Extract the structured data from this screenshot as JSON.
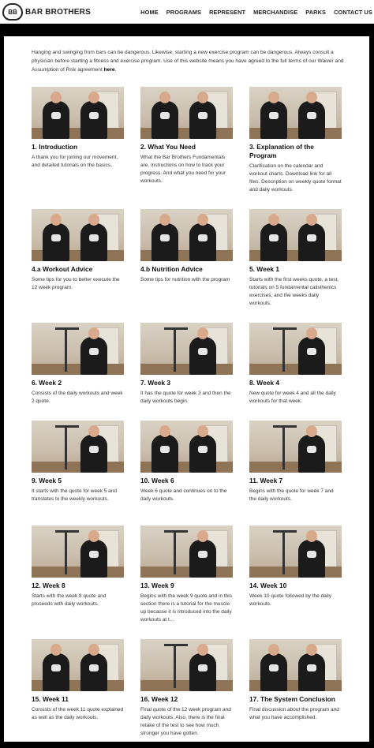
{
  "header": {
    "logo_text": "BAR BROTHERS",
    "nav": [
      "HOME",
      "PROGRAMS",
      "REPRESENT",
      "MERCHANDISE",
      "PARKS",
      "CONTACT US"
    ]
  },
  "disclaimer": {
    "text": "Hanging and swinging from bars can be dangerous. Likewise, starting a new exercise program can be dangerous. Always consult a physician before starting a fitness and exercise program. Use of this website means you have agreed to the full terms of our Waiver and Assumption of Risk agreement ",
    "link": "here",
    "end": "."
  },
  "cards": [
    {
      "title": "1. Introduction",
      "desc": "A thank you for joining our movement, and detailed tutorials on the basics."
    },
    {
      "title": "2. What You Need",
      "desc": "What the Bar Brothers Fundamentals are. Instructions on how to track your progress. And what you need for your workouts."
    },
    {
      "title": "3. Explanation of the Program",
      "desc": "Clarification on the calendar and workout charts. Download link for all files. Description on weekly quote format and daily workouts."
    },
    {
      "title": "4.a Workout Advice",
      "desc": "Some tips for you to better execute the 12 week program."
    },
    {
      "title": "4.b Nutrition Advice",
      "desc": "Some tips for nutrition with the program"
    },
    {
      "title": "5. Week 1",
      "desc": "Starts with the first weeks quote, a test, tutorials on 5 fundamental calisthenics exercises, and the weeks daily workouts."
    },
    {
      "title": "6. Week 2",
      "desc": "Consists of the daily workouts and week 2 quote."
    },
    {
      "title": "7. Week 3",
      "desc": "It has the quote for week 3 and then the daily workouts begin."
    },
    {
      "title": "8. Week 4",
      "desc": "New quote for week 4 and all the daily workouts for that week."
    },
    {
      "title": "9. Week 5",
      "desc": "It starts with the quote for week 5 and translates to the weekly workouts."
    },
    {
      "title": "10. Week 6",
      "desc": "Week 6 quote and continues on to the daily workouts."
    },
    {
      "title": "11. Week 7",
      "desc": "Begins with the quote for week 7 and the daily workouts."
    },
    {
      "title": "12. Week 8",
      "desc": "Starts with the week 8 quote and proceeds with daily workouts."
    },
    {
      "title": "13. Week 9",
      "desc": "Begins with the week 9 quote and in this section there is a tutorial for the muscle up because it is introduced into the daily workouts at t..."
    },
    {
      "title": "14. Week 10",
      "desc": "Week 10 quote followed by the daily workouts."
    },
    {
      "title": "15. Week 11",
      "desc": "Consists of the week 11 quote explained as well as the daily workouts."
    },
    {
      "title": "16. Week 12",
      "desc": "Final quote of the 12 week program and daily workouts. Also, there is the final retake of the test to see how much stronger you have gotten."
    },
    {
      "title": "17. The System Conclusion",
      "desc": "Final discussion about the program and what you have accomplished."
    }
  ]
}
